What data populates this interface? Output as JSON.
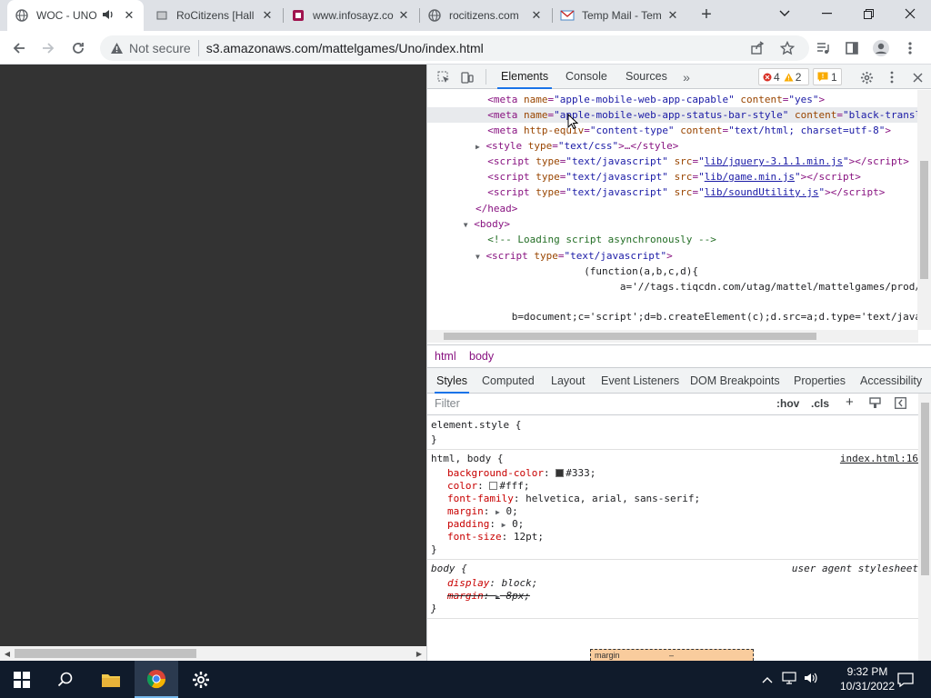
{
  "tabs": [
    {
      "title": "WOC - UNO",
      "active": true
    },
    {
      "title": "RoCitizens [Hall",
      "active": false
    },
    {
      "title": "www.infosayz.co",
      "active": false
    },
    {
      "title": "rocitizens.com",
      "active": false
    },
    {
      "title": "Temp Mail - Tem",
      "active": false
    }
  ],
  "toolbar": {
    "security_label": "Not secure",
    "url": "s3.amazonaws.com/mattelgames/Uno/index.html"
  },
  "devtools": {
    "tabs": [
      "Elements",
      "Console",
      "Sources"
    ],
    "badges": {
      "errors": "4",
      "warnings": "2",
      "issues": "1"
    },
    "code": {
      "l1_a": "name",
      "l1_v": "\"apple-mobile-web-app-capable\"",
      "l1_a2": "content",
      "l1_v2": "\"yes\"",
      "l2_a": "name",
      "l2_v": "\"apple-mobile-web-app-status-bar-style\"",
      "l2_a2": "content",
      "l2_v2": "\"black-translucer",
      "l3_a": "http-equiv",
      "l3_v": "\"content-type\"",
      "l3_a2": "content",
      "l3_v2": "\"text/html; charset=utf-8\"",
      "l4_a": "type",
      "l4_v": "\"text/css\"",
      "l5_src": "lib/jquery-3.1.1.min.js",
      "l6_src": "lib/game.min.js",
      "l7_src": "lib/soundUtility.js",
      "script_type": "\"text/javascript\"",
      "comment": "<!-- Loading script asynchronously -->",
      "js1": "(function(a,b,c,d){",
      "js2": "a='//tags.tiqcdn.com/utag/mattel/mattelgames/prod/utag.js",
      "js3": "b=document;c='script';d=b.createElement(c);d.src=a;d.type='text/java'+"
    },
    "breadcrumbs": [
      "html",
      "body"
    ],
    "subtabs": [
      "Styles",
      "Computed",
      "Layout",
      "Event Listeners",
      "DOM Breakpoints",
      "Properties",
      "Accessibility"
    ],
    "filter_placeholder": "Filter",
    "filter_hov": ":hov",
    "filter_cls": ".cls",
    "styles": {
      "element_style": "element.style {",
      "rule1_selector": "html, body {",
      "rule1_source": "index.html:16",
      "bg_prop": "background-color",
      "bg_val": "#333;",
      "color_prop": "color",
      "color_val": "#fff;",
      "font_prop": "font-family",
      "font_val": "helvetica, arial, sans-serif;",
      "margin_prop": "margin",
      "margin_val": "0;",
      "padding_prop": "padding",
      "padding_val": "0;",
      "fsize_prop": "font-size",
      "fsize_val": "12pt;",
      "rule2_selector": "body {",
      "rule2_source": "user agent stylesheet",
      "display_prop": "display",
      "display_val": "block;",
      "ua_margin_prop": "margin",
      "ua_margin_val": "8px;",
      "boxmodel_label": "margin",
      "boxmodel_value": "–"
    }
  },
  "taskbar": {
    "time": "9:32 PM",
    "date": "10/31/2022"
  },
  "colors": {
    "page_bg": "#333333",
    "taskbar_bg": "#101b2b",
    "accent": "#1a73e8"
  }
}
